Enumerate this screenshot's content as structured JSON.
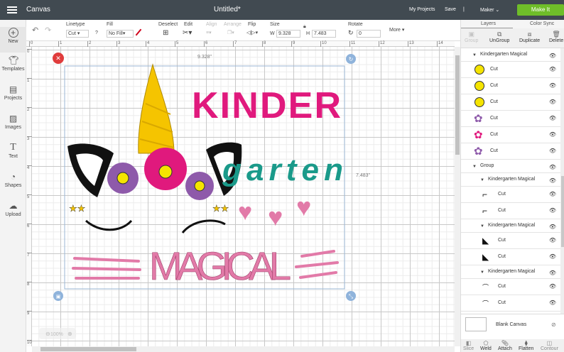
{
  "app": {
    "section": "Canvas",
    "title": "Untitled*",
    "my_projects": "My Projects",
    "save": "Save",
    "sep": "|",
    "machine": "Maker",
    "make_it": "Make It"
  },
  "sidebar": [
    {
      "label": "New",
      "icon": "plus-circle"
    },
    {
      "label": "Templates",
      "icon": "shirt"
    },
    {
      "label": "Projects",
      "icon": "book"
    },
    {
      "label": "Images",
      "icon": "image"
    },
    {
      "label": "Text",
      "icon": "text-T"
    },
    {
      "label": "Shapes",
      "icon": "shapes"
    },
    {
      "label": "Upload",
      "icon": "cloud-upload"
    }
  ],
  "toolbar": {
    "linetype_label": "Linetype",
    "linetype_value": "Cut",
    "help": "?",
    "fill_label": "Fill",
    "fill_value": "No Fill",
    "fill_color": "#d0021b",
    "deselect": "Deselect",
    "edit": "Edit",
    "align": "Align",
    "arrange": "Arrange",
    "flip": "Flip",
    "size": "Size",
    "w_label": "W",
    "w_value": "9.328",
    "h_label": "H",
    "h_value": "7.483",
    "rotate": "Rotate",
    "rotate_value": "0",
    "more": "More"
  },
  "ruler": {
    "top": [
      "0",
      "1",
      "2",
      "3",
      "4",
      "5",
      "6",
      "7",
      "8",
      "9",
      "10",
      "11",
      "12",
      "13",
      "14"
    ],
    "left": [
      "0",
      "1",
      "2",
      "3",
      "4",
      "5",
      "6",
      "7",
      "8",
      "9",
      "10"
    ]
  },
  "canvas": {
    "width_dim": "9.328\"",
    "height_dim": "7.483\"",
    "zoom": "100%",
    "words": {
      "kinder": "KINDER",
      "garten": "garten",
      "magical": "MAGICAL"
    }
  },
  "panel": {
    "tabs": [
      "Layers",
      "Color Sync"
    ],
    "buttons": [
      "Group",
      "UnGroup",
      "Duplicate",
      "Delete"
    ],
    "layers": [
      {
        "type": "group",
        "label": "Kindergarten Magical",
        "indent": 0
      },
      {
        "type": "item",
        "label": "Cut",
        "thumb": "circle",
        "color": "#f5e400"
      },
      {
        "type": "item",
        "label": "Cut",
        "thumb": "circle",
        "color": "#f5e400"
      },
      {
        "type": "item",
        "label": "Cut",
        "thumb": "circle",
        "color": "#f5e400"
      },
      {
        "type": "item",
        "label": "Cut",
        "thumb": "flower",
        "color": "#8e5aaa"
      },
      {
        "type": "item",
        "label": "Cut",
        "thumb": "flower",
        "color": "#e0197d"
      },
      {
        "type": "item",
        "label": "Cut",
        "thumb": "flower",
        "color": "#8e5aaa"
      },
      {
        "type": "group",
        "label": "Group",
        "indent": 0
      },
      {
        "type": "group",
        "label": "Kindergarten Magical",
        "indent": 1
      },
      {
        "type": "item",
        "label": "Cut",
        "thumb": "ear",
        "color": "#111111",
        "indent": 1
      },
      {
        "type": "item",
        "label": "Cut",
        "thumb": "ear",
        "color": "#111111",
        "indent": 1
      },
      {
        "type": "group",
        "label": "Kindergarten Magical",
        "indent": 1
      },
      {
        "type": "item",
        "label": "Cut",
        "thumb": "ear-fill",
        "color": "#111111",
        "indent": 1
      },
      {
        "type": "item",
        "label": "Cut",
        "thumb": "ear-fill",
        "color": "#111111",
        "indent": 1
      },
      {
        "type": "group",
        "label": "Kindergarten Magical",
        "indent": 1
      },
      {
        "type": "item",
        "label": "Cut",
        "thumb": "lash",
        "color": "#111111",
        "indent": 1
      },
      {
        "type": "item",
        "label": "Cut",
        "thumb": "lash",
        "color": "#111111",
        "indent": 1
      }
    ],
    "blank_canvas": "Blank Canvas",
    "bottom": [
      "Slice",
      "Weld",
      "Attach",
      "Flatten",
      "Contour"
    ]
  },
  "colors": {
    "topbar": "#414a51",
    "make_it": "#6fbe29",
    "pink": "#e0197d",
    "teal": "#1a9a8a",
    "magical": "#e27aa8",
    "yellow": "#f5c400",
    "purple": "#8e5aaa"
  }
}
